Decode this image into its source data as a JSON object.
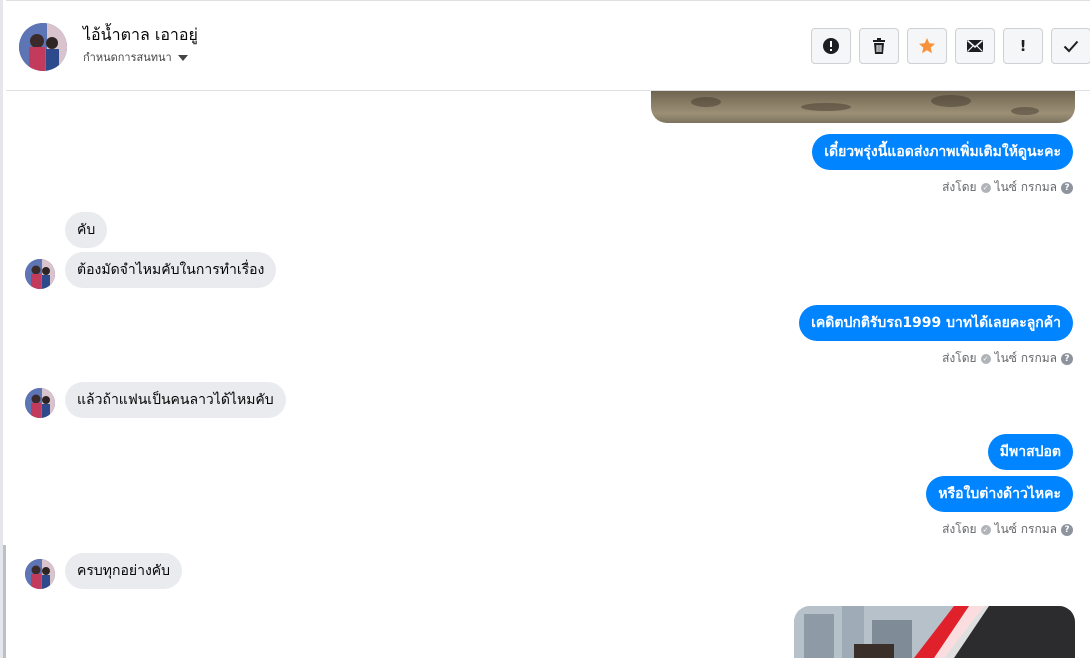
{
  "header": {
    "contact_name": "ไอ้น้ำตาล เอาอยู่",
    "conversation_label": "กำหนดการสนทนา",
    "toolbar": [
      {
        "icon": "alert-circle-icon",
        "label": "spam"
      },
      {
        "icon": "trash-icon",
        "label": "delete"
      },
      {
        "icon": "star-icon",
        "label": "star",
        "color": "#f7923b"
      },
      {
        "icon": "envelope-icon",
        "label": "mark-unread"
      },
      {
        "icon": "exclamation-icon",
        "label": "!"
      },
      {
        "icon": "check-icon",
        "label": "done"
      }
    ]
  },
  "messages": {
    "out_1": "เดี๋ยวพรุ่งนี้แอดส่งภาพเพิ่มเติมให้ดูนะคะ",
    "sent_by_1": "ส่งโดย",
    "sender_1": "ไนซ์ กรกมล",
    "in_1": "คับ",
    "in_2": "ต้องมัดจำไหมคับในการทำเรื่อง",
    "out_2": "เคดิตปกติรับรถ1999 บาทได้เลยคะลูกค้า",
    "sent_by_2": "ส่งโดย",
    "sender_2": "ไนซ์ กรกมล",
    "in_3": "แล้วถ้าแฟนเป็นคนลาวได้ไหมคับ",
    "out_3": "มีพาสปอต",
    "out_4": "หรือใบต่างด้าวไหคะ",
    "sent_by_3": "ส่งโดย",
    "sender_3": "ไนซ์ กรกมล",
    "in_4": "ครบทุกอย่างคับ"
  },
  "colors": {
    "outgoing_bubble": "#0084ff",
    "incoming_bubble": "#e9ebee",
    "star": "#f7923b"
  }
}
